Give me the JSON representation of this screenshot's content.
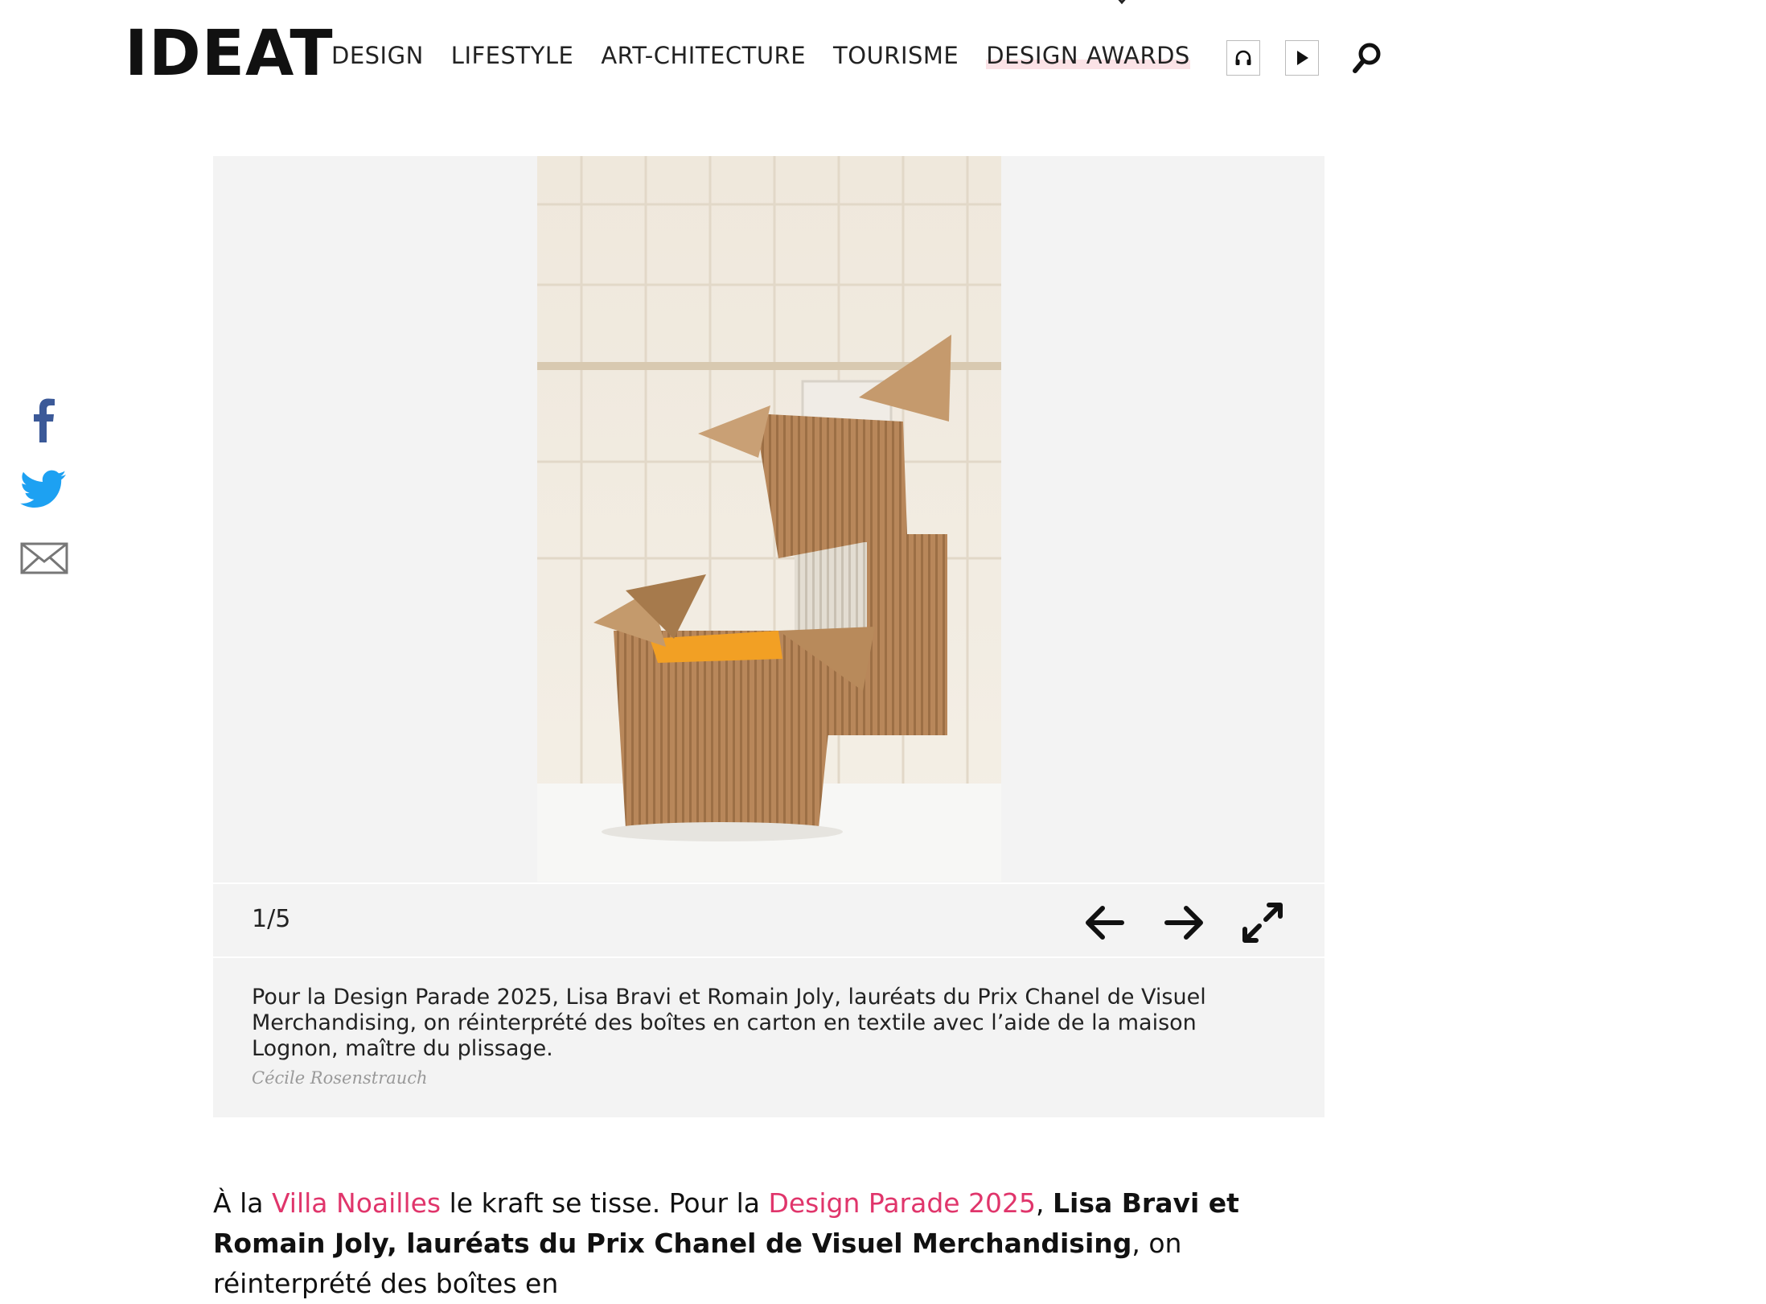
{
  "header": {
    "logo": "IDEAT",
    "nav": [
      "DESIGN",
      "LIFESTYLE",
      "ART-CHITECTURE",
      "TOURISME",
      "DESIGN AWARDS"
    ],
    "icons": {
      "audio": "headphones-icon",
      "video": "play-icon",
      "search": "search-icon"
    }
  },
  "share": {
    "items": [
      "facebook-icon",
      "twitter-icon",
      "email-icon"
    ],
    "colors": {
      "facebook": "#3b5998",
      "twitter": "#1da1f2",
      "email": "#777777"
    }
  },
  "gallery": {
    "counter": "1/5",
    "controls": {
      "prev": "arrow-left-icon",
      "next": "arrow-right-icon",
      "fullscreen": "expand-icon"
    },
    "caption": "Pour la Design Parade 2025, Lisa Bravi et Romain Joly, lauréats du Prix Chanel de Visuel Merchandising, on réinterprété des boîtes en carton en textile avec l’aide de la maison Lognon, maître du plissage.",
    "credit": "Cécile Rosenstrauch"
  },
  "article": {
    "p1_a": "À la ",
    "p1_link1": "Villa Noailles",
    "p1_b": " le kraft se tisse. Pour la ",
    "p1_link2": "Design Parade 2025",
    "p1_c": ", ",
    "p1_bold": "Lisa Bravi et Romain Joly, lauréats du Prix Chanel de Visuel Merchandising",
    "p1_d": ", on réinterprété des boîtes en"
  },
  "colors": {
    "link": "#e0356b",
    "awards_highlight": "#fbe2e6",
    "gallery_bg": "#f3f3f3"
  }
}
